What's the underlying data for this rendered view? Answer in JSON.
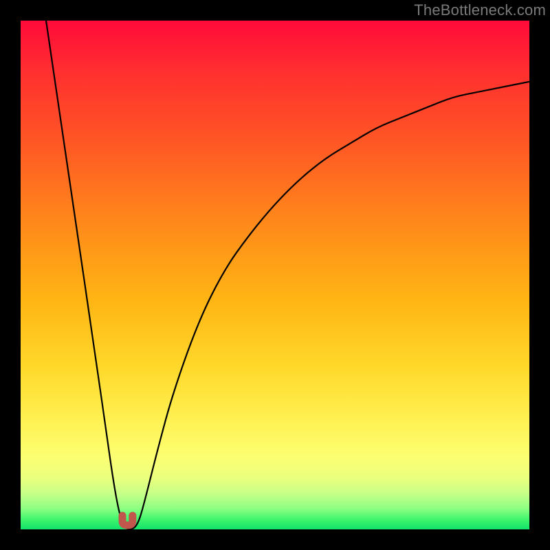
{
  "watermark": "TheBottleneck.com",
  "chart_data": {
    "type": "line",
    "title": "",
    "xlabel": "",
    "ylabel": "",
    "xlim": [
      0,
      100
    ],
    "ylim": [
      0,
      100
    ],
    "grid": false,
    "legend": false,
    "series": [
      {
        "name": "bottleneck-curve",
        "x": [
          5,
          10,
          15,
          17,
          18,
          19,
          20,
          21,
          22,
          23,
          24,
          27,
          30,
          35,
          40,
          45,
          50,
          55,
          60,
          65,
          70,
          75,
          80,
          85,
          90,
          95,
          100
        ],
        "y": [
          100,
          66,
          32,
          18,
          11,
          5,
          1,
          0,
          0,
          1,
          4,
          16,
          27,
          41,
          51,
          58,
          64,
          69,
          73,
          76,
          79,
          81,
          83,
          85,
          86,
          87,
          88
        ]
      }
    ],
    "marker": {
      "x_range": [
        20,
        22
      ],
      "y": 0,
      "color": "#c0564c"
    },
    "colors": {
      "curve": "#000000",
      "background_top": "#ff0a3a",
      "background_bottom": "#11e36a"
    }
  }
}
